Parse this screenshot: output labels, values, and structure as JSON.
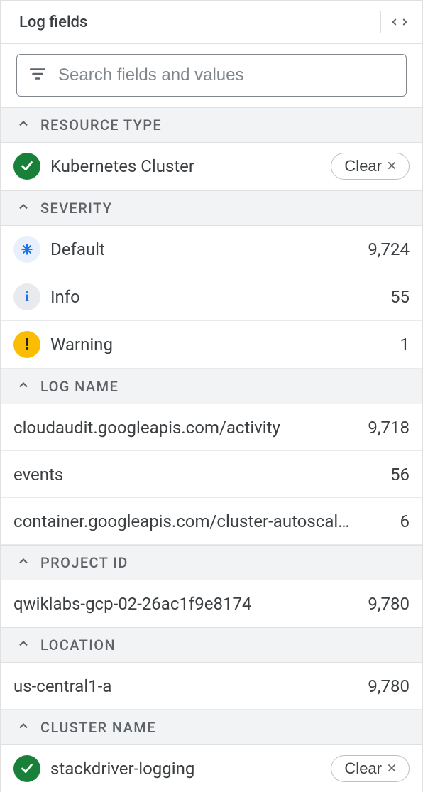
{
  "header": {
    "title": "Log fields"
  },
  "search": {
    "placeholder": "Search fields and values",
    "value": ""
  },
  "clear_label": "Clear",
  "sections": {
    "resource_type": {
      "title": "RESOURCE TYPE",
      "items": [
        {
          "icon": "check",
          "label": "Kubernetes Cluster",
          "clearable": true
        }
      ]
    },
    "severity": {
      "title": "SEVERITY",
      "items": [
        {
          "icon": "star",
          "label": "Default",
          "count": "9,724"
        },
        {
          "icon": "info",
          "label": "Info",
          "count": "55"
        },
        {
          "icon": "warn",
          "label": "Warning",
          "count": "1"
        }
      ]
    },
    "log_name": {
      "title": "LOG NAME",
      "items": [
        {
          "label": "cloudaudit.googleapis.com/activity",
          "count": "9,718"
        },
        {
          "label": "events",
          "count": "56"
        },
        {
          "label": "container.googleapis.com/cluster-autoscal…",
          "count": "6"
        }
      ]
    },
    "project_id": {
      "title": "PROJECT ID",
      "items": [
        {
          "label": "qwiklabs-gcp-02-26ac1f9e8174",
          "count": "9,780"
        }
      ]
    },
    "location": {
      "title": "LOCATION",
      "items": [
        {
          "label": "us-central1-a",
          "count": "9,780"
        }
      ]
    },
    "cluster_name": {
      "title": "CLUSTER NAME",
      "items": [
        {
          "icon": "check",
          "label": "stackdriver-logging",
          "clearable": true
        }
      ]
    }
  }
}
